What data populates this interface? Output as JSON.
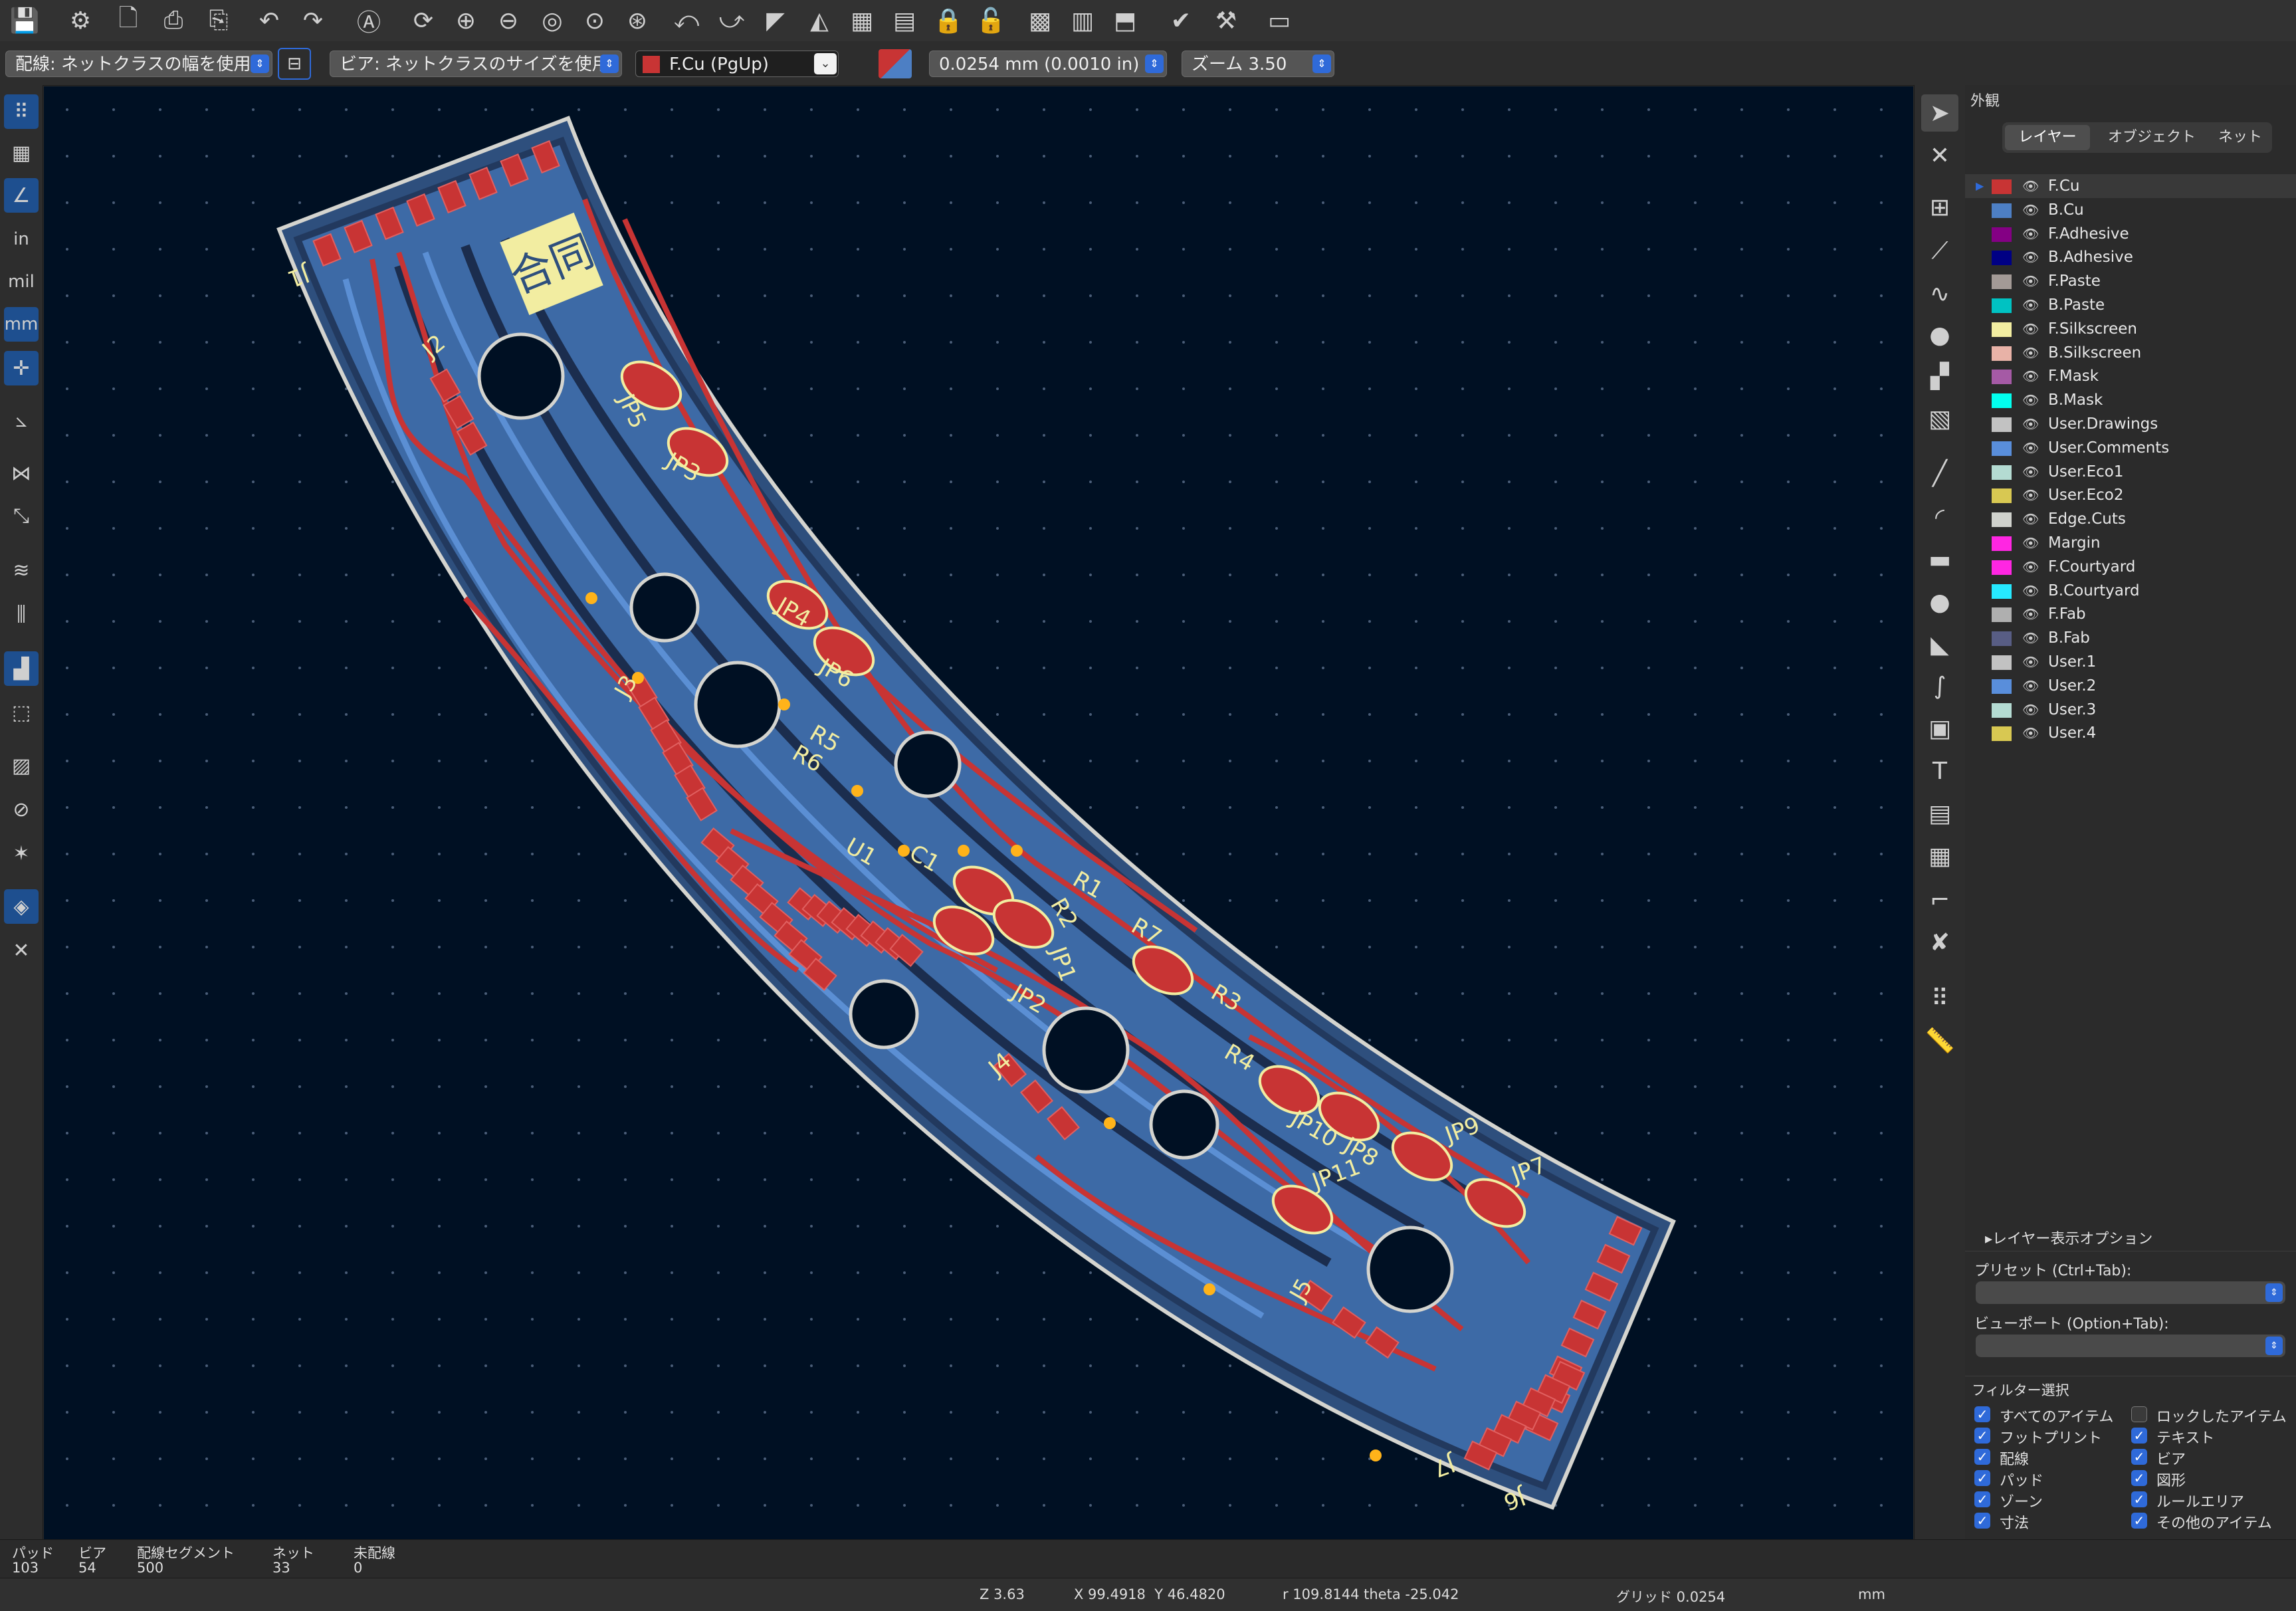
{
  "toolbar": {
    "icons": [
      "save-icon",
      "board-setup-icon",
      "page-settings-icon",
      "print-icon",
      "plot-icon",
      "undo-icon",
      "redo-icon",
      "find-icon",
      "redraw-icon",
      "zoom-in-icon",
      "zoom-out-icon",
      "zoom-fit-icon",
      "zoom-objects-icon",
      "zoom-selection-icon",
      "rotate-ccw-icon",
      "rotate-cw-icon",
      "flip-icon",
      "mirror-icon",
      "group-icon",
      "ungroup-icon",
      "lock-icon",
      "unlock-icon",
      "footprint-editor-icon",
      "footprint-browser-icon",
      "update-pcb-icon",
      "drc-icon",
      "scripting-icon",
      "console-icon"
    ]
  },
  "options": {
    "track_width": "配線: ネットクラスの幅を使用",
    "via_size": "ビア: ネットクラスのサイズを使用",
    "layer": "F.Cu (PgUp)",
    "grid": "0.0254 mm (0.0010 in)",
    "zoom": "ズーム 3.50"
  },
  "left_toolbar": {
    "units_in": "in",
    "units_mil": "mil",
    "units_mm": "mm"
  },
  "board": {
    "refs": [
      {
        "t": "J1"
      },
      {
        "t": "J2"
      },
      {
        "t": "J3"
      },
      {
        "t": "J4"
      },
      {
        "t": "J5"
      },
      {
        "t": "J6"
      },
      {
        "t": "J7"
      },
      {
        "t": "JP5"
      },
      {
        "t": "JP3"
      },
      {
        "t": "JP4"
      },
      {
        "t": "JP6"
      },
      {
        "t": "R5"
      },
      {
        "t": "R6"
      },
      {
        "t": "U1"
      },
      {
        "t": "C1"
      },
      {
        "t": "R1"
      },
      {
        "t": "R2"
      },
      {
        "t": "JP1"
      },
      {
        "t": "JP2"
      },
      {
        "t": "R7"
      },
      {
        "t": "R3"
      },
      {
        "t": "R4"
      },
      {
        "t": "JP10"
      },
      {
        "t": "JP8"
      },
      {
        "t": "JP9"
      },
      {
        "t": "JP7"
      },
      {
        "t": "JP11"
      }
    ],
    "logo_text": "合同"
  },
  "panel": {
    "title": "外観",
    "tabs": [
      "レイヤー",
      "オブジェクト",
      "ネット"
    ],
    "layers": [
      {
        "name": "F.Cu",
        "color": "#c83434"
      },
      {
        "name": "B.Cu",
        "color": "#4d7fc4"
      },
      {
        "name": "F.Adhesive",
        "color": "#840084"
      },
      {
        "name": "B.Adhesive",
        "color": "#000084"
      },
      {
        "name": "F.Paste",
        "color": "#a39a96"
      },
      {
        "name": "B.Paste",
        "color": "#00c2c2"
      },
      {
        "name": "F.Silkscreen",
        "color": "#f2eda1"
      },
      {
        "name": "B.Silkscreen",
        "color": "#e8b2a7"
      },
      {
        "name": "F.Mask",
        "color": "#a55aa5"
      },
      {
        "name": "B.Mask",
        "color": "#02ffee"
      },
      {
        "name": "User.Drawings",
        "color": "#c2c2c2"
      },
      {
        "name": "User.Comments",
        "color": "#598edb"
      },
      {
        "name": "User.Eco1",
        "color": "#b4dbd2"
      },
      {
        "name": "User.Eco2",
        "color": "#d8c852"
      },
      {
        "name": "Edge.Cuts",
        "color": "#d0d2cd"
      },
      {
        "name": "Margin",
        "color": "#ff26e2"
      },
      {
        "name": "F.Courtyard",
        "color": "#ff26e2"
      },
      {
        "name": "B.Courtyard",
        "color": "#26e9ff"
      },
      {
        "name": "F.Fab",
        "color": "#afafaf"
      },
      {
        "name": "B.Fab",
        "color": "#585d84"
      },
      {
        "name": "User.1",
        "color": "#c2c2c2"
      },
      {
        "name": "User.2",
        "color": "#598edb"
      },
      {
        "name": "User.3",
        "color": "#b4dbd2"
      },
      {
        "name": "User.4",
        "color": "#d8c852"
      }
    ],
    "layer_display_options": "▸レイヤー表示オプション",
    "preset_label": "プリセット (Ctrl+Tab):",
    "viewport_label": "ビューポート (Option+Tab):",
    "filter_title": "フィルター選択",
    "filters_left": [
      {
        "label": "すべてのアイテム",
        "checked": true
      },
      {
        "label": "フットプリント",
        "checked": true
      },
      {
        "label": "配線",
        "checked": true
      },
      {
        "label": "パッド",
        "checked": true
      },
      {
        "label": "ゾーン",
        "checked": true
      },
      {
        "label": "寸法",
        "checked": true
      }
    ],
    "filters_right": [
      {
        "label": "ロックしたアイテム",
        "checked": false
      },
      {
        "label": "テキスト",
        "checked": true
      },
      {
        "label": "ビア",
        "checked": true
      },
      {
        "label": "図形",
        "checked": true
      },
      {
        "label": "ルールエリア",
        "checked": true
      },
      {
        "label": "その他のアイテム",
        "checked": true
      }
    ]
  },
  "stats": {
    "pads_label": "パッド",
    "pads": "103",
    "vias_label": "ビア",
    "vias": "54",
    "tracks_label": "配線セグメント",
    "tracks": "500",
    "nets_label": "ネット",
    "nets": "33",
    "unrouted_label": "未配線",
    "unrouted": "0"
  },
  "status": {
    "zoom": "Z 3.63",
    "xy": "X 99.4918  Y 46.4820",
    "polar": "r 109.8144  theta -25.042",
    "grid": "グリッド 0.0254",
    "units": "mm"
  }
}
